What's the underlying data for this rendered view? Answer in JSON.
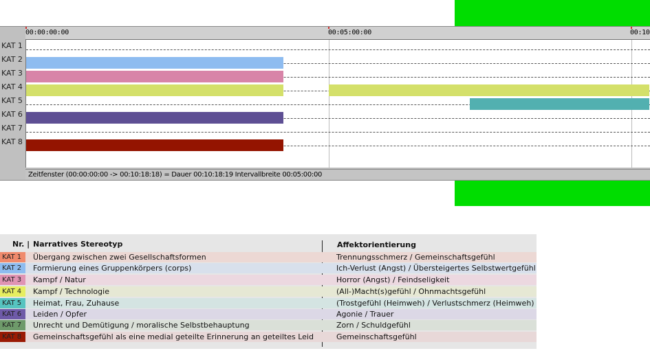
{
  "timeline": {
    "ticks": [
      "00:00:00:00",
      "00:05:00:00",
      "00:10"
    ],
    "rows": [
      "KAT 1",
      "KAT 2",
      "KAT 3",
      "KAT 4",
      "KAT 5",
      "KAT 6",
      "KAT 7",
      "KAT 8"
    ],
    "bars": [
      {
        "row": 1,
        "start": "00:00:00",
        "end": "00:04:15",
        "color": "#8ebcf0"
      },
      {
        "row": 2,
        "start": "00:00:00",
        "end": "00:04:15",
        "color": "#d884a8"
      },
      {
        "row": 3,
        "start": "00:00:00",
        "end": "00:04:15",
        "color": "#d4e06a"
      },
      {
        "row": 3,
        "start": "00:05:00",
        "end": "00:10:18",
        "color": "#d4e06a"
      },
      {
        "row": 4,
        "start": "00:07:20",
        "end": "00:10:18",
        "color": "#52b0b0"
      },
      {
        "row": 5,
        "start": "00:00:00",
        "end": "00:04:15",
        "color": "#5e4f94"
      },
      {
        "row": 7,
        "start": "00:00:00",
        "end": "00:04:15",
        "color": "#941400"
      }
    ],
    "status": "Zeitfenster (00:00:00:00 -> 00:10:18:18) = Dauer 00:10:18:19     Intervallbreite 00:05:00:00"
  },
  "legend": {
    "headers": {
      "nr": "Nr. |",
      "narrative": "Narratives Stereotyp",
      "affekt": "Affektorientierung"
    },
    "rows": [
      {
        "kat": "KAT 1",
        "chip": "#f08a6c",
        "bg": "#ecd8d4",
        "narrative": "Übergang zwischen zwei Gesellschaftsformen",
        "affekt": "Trennungsschmerz / Gemeinschaftsgefühl"
      },
      {
        "kat": "KAT 2",
        "chip": "#8ebcf0",
        "bg": "#d8e0ec",
        "narrative": "Formierung eines Gruppenkörpers (corps)",
        "affekt": "Ich-Verlust (Angst) / Übersteigertes Selbstwertgefühl"
      },
      {
        "kat": "KAT 3",
        "chip": "#e094b4",
        "bg": "#ecd8e0",
        "narrative": "Kampf / Natur",
        "affekt": "Horror (Angst) / Feindseligkeit"
      },
      {
        "kat": "KAT 4",
        "chip": "#e6ee60",
        "bg": "#e6e8d4",
        "narrative": "Kampf / Technologie",
        "affekt": "(All-)Macht(s)gefühl / Ohnmachtsgefühl"
      },
      {
        "kat": "KAT 5",
        "chip": "#56c4c0",
        "bg": "#d4e4e2",
        "narrative": "Heimat, Frau, Zuhause",
        "affekt": "(Trostgefühl (Heimweh) / Verlustschmerz (Heimweh)"
      },
      {
        "kat": "KAT 6",
        "chip": "#6e5aa8",
        "bg": "#dcd8e6",
        "narrative": "Leiden / Opfer",
        "affekt": "Agonie / Trauer"
      },
      {
        "kat": "KAT 7",
        "chip": "#6e9a6a",
        "bg": "#dae0d8",
        "narrative": "Unrecht und Demütigung / moralische Selbstbehauptung",
        "affekt": "Zorn / Schuldgefühl"
      },
      {
        "kat": "KAT 8",
        "chip": "#9a1a04",
        "bg": "#e8d8d8",
        "narrative": "Gemeinschaftsgefühl als eine medial geteilte Erinnerung an geteiltes Leid",
        "affekt": "Gemeinschaftsgefühl"
      }
    ]
  }
}
